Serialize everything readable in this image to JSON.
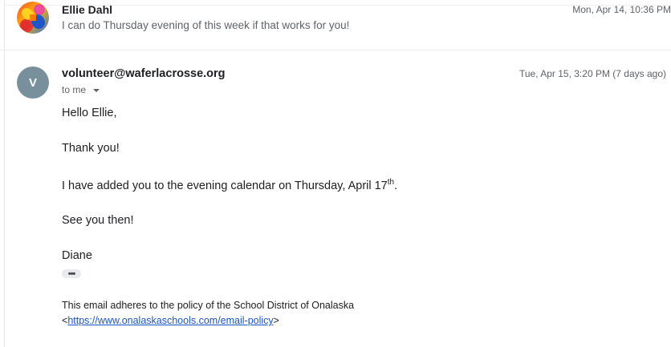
{
  "collapsed_message": {
    "sender": "Ellie Dahl",
    "snippet": "I can do Thursday evening of this week if that works for you!",
    "date": "Mon, Apr 14, 10:36 PM"
  },
  "expanded_message": {
    "avatar_letter": "V",
    "from": "volunteer@waferlacrosse.org",
    "date": "Tue, Apr 15, 3:20 PM (7 days ago)",
    "to_label": "to me",
    "body": {
      "greeting": "Hello Ellie,",
      "line1": "Thank you!",
      "line2_before": "I have added you to the evening calendar on Thursday, April 17",
      "line2_sup": "th",
      "line2_after": ".",
      "line3": "See you then!",
      "signature": "Diane"
    },
    "trimmed_content_label": "•••",
    "footer": {
      "line1": "This email adheres to the policy of the School District of Onalaska",
      "link_open": "<",
      "link_text": "https://www.onalaskaschools.com/email-policy",
      "link_close": ">"
    }
  },
  "icons": {
    "avatar_photo": "profile-photo-icon",
    "caret": "chevron-down-icon"
  }
}
